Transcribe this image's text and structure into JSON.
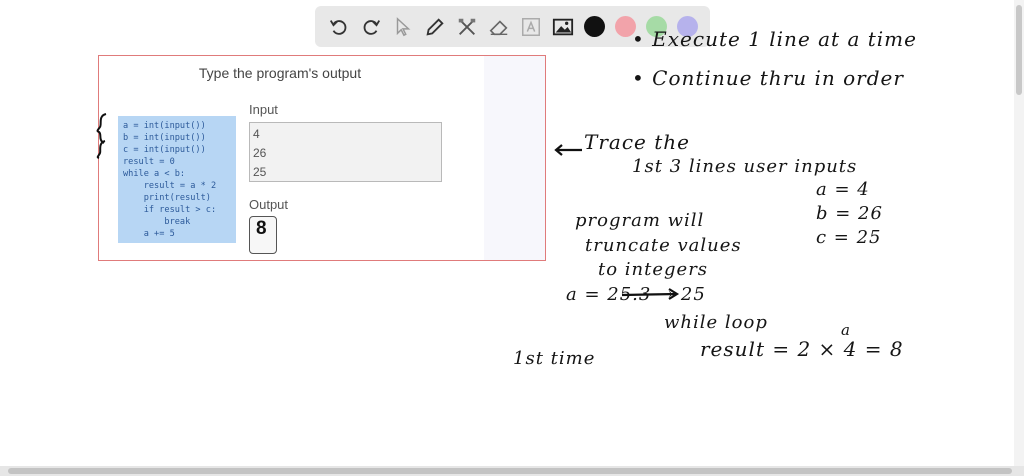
{
  "toolbar": {
    "tools": [
      {
        "name": "undo-icon"
      },
      {
        "name": "redo-icon"
      },
      {
        "name": "pointer-icon"
      },
      {
        "name": "pen-icon"
      },
      {
        "name": "tools-icon"
      },
      {
        "name": "eraser-icon"
      },
      {
        "name": "text-icon"
      },
      {
        "name": "image-icon"
      }
    ],
    "colors": [
      "#111111",
      "#f2a3aa",
      "#a6dba6",
      "#b6b2ec"
    ]
  },
  "problem": {
    "title": "Type the program's output",
    "code_lines": [
      "a = int(input())",
      "b = int(input())",
      "c = int(input())",
      "result = 0",
      "while a < b:",
      "    result = a * 2",
      "    print(result)",
      "    if result > c:",
      "        break",
      "    a += 5"
    ],
    "input_label": "Input",
    "input_values": [
      "4",
      "26",
      "25"
    ],
    "output_label": "Output",
    "output_value": "8"
  },
  "notes": {
    "line1": "• Execute 1 line at a time",
    "line2": "• Continue thru in order",
    "trace": "Trace the",
    "trace2": "1st 3 lines  user inputs",
    "assign_a": "a = 4",
    "assign_b": "b = 26",
    "assign_c": "c = 25",
    "prog1": "program will",
    "prog2": "truncate values",
    "prog3": "to integers",
    "example": "a = 25.3 → 25",
    "loop": "while loop",
    "first": "1st   time",
    "result": "result = 2 × 4 = 8",
    "super_a": "a"
  }
}
